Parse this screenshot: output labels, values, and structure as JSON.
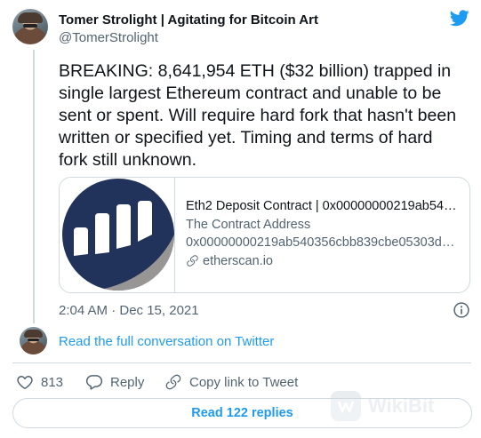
{
  "author": {
    "display_name": "Tomer Strolight | Agitating for Bitcoin Art",
    "handle": "@TomerStrolight"
  },
  "tweet": {
    "text": "BREAKING: 8,641,954 ETH ($32 billion) trapped in\nsingle largest Ethereum contract and unable to be\nsent or spent. Will require hard fork that hasn't been\nwritten or specified yet. Timing and terms of hard\nfork still unknown.",
    "timestamp": "2:04 AM · Dec 15, 2021"
  },
  "card": {
    "title": "Eth2 Deposit Contract | 0x00000000219ab54…",
    "subtitle": "The Contract Address",
    "address": "0x00000000219ab540356cbb839cbe05303d…",
    "domain": "etherscan.io"
  },
  "conversation": {
    "link_text": "Read the full conversation on Twitter"
  },
  "actions": {
    "like_count": "813",
    "reply_label": "Reply",
    "copy_label": "Copy link to Tweet"
  },
  "replies_button": {
    "label": "Read 122 replies"
  },
  "watermark": {
    "text": "WikiBit"
  },
  "colors": {
    "accent": "#1d9bf0",
    "text_primary": "#0f1419",
    "text_secondary": "#536471",
    "border": "#cfd9de",
    "etherscan_navy": "#21325b",
    "etherscan_gray": "#979695"
  },
  "icons": {
    "twitter_logo": "twitter-bird-icon",
    "info": "info-icon",
    "like": "heart-icon",
    "reply": "reply-bubble-icon",
    "copy": "link-icon",
    "domain": "link-icon"
  }
}
